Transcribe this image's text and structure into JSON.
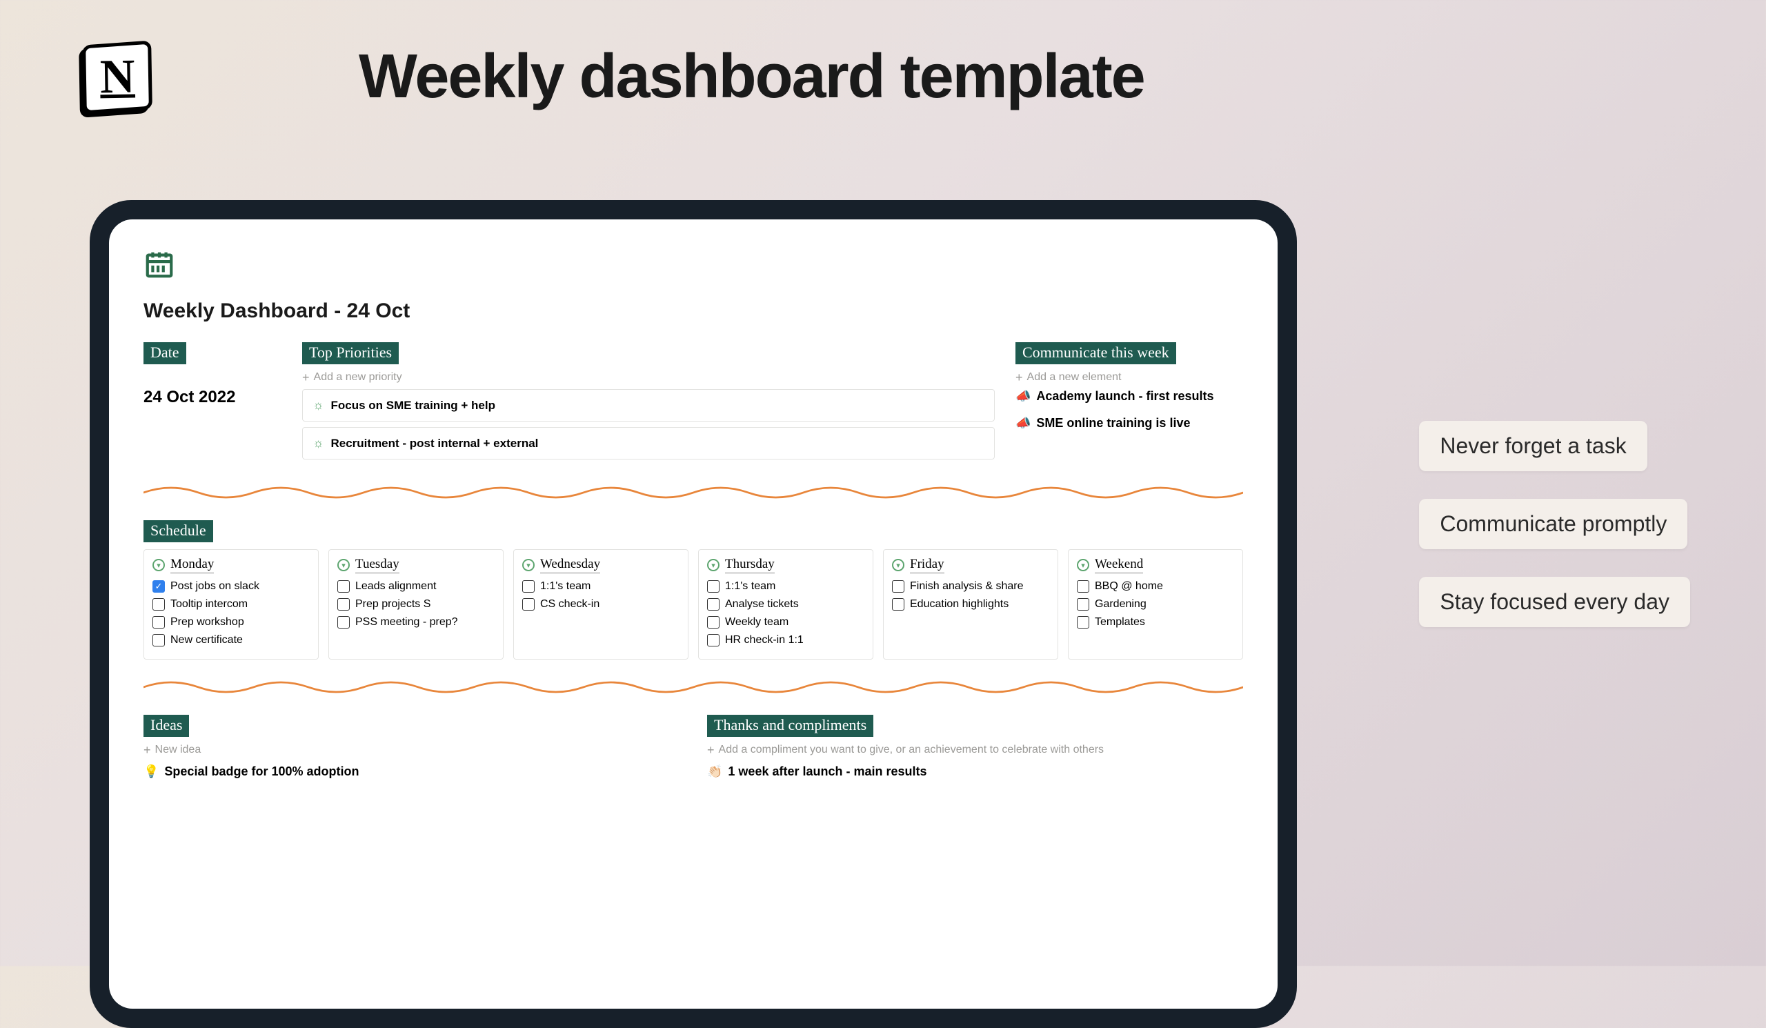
{
  "header": {
    "title": "Weekly dashboard template"
  },
  "page": {
    "title": "Weekly Dashboard - 24 Oct"
  },
  "sections": {
    "date": {
      "label": "Date",
      "value": "24 Oct 2022"
    },
    "priorities": {
      "label": "Top Priorities",
      "add": "Add a new priority",
      "items": [
        "Focus on SME training + help",
        "Recruitment - post internal + external"
      ]
    },
    "communicate": {
      "label": "Communicate this week",
      "add": "Add a new element",
      "items": [
        "Academy launch - first results",
        "SME online training is live"
      ]
    },
    "schedule": {
      "label": "Schedule",
      "days": [
        {
          "name": "Monday",
          "tasks": [
            {
              "text": "Post jobs on slack",
              "done": true
            },
            {
              "text": "Tooltip intercom",
              "done": false
            },
            {
              "text": "Prep  workshop",
              "done": false
            },
            {
              "text": "New certificate",
              "done": false
            }
          ]
        },
        {
          "name": "Tuesday",
          "tasks": [
            {
              "text": "Leads alignment",
              "done": false
            },
            {
              "text": "Prep projects S",
              "done": false
            },
            {
              "text": "PSS meeting - prep?",
              "done": false
            }
          ]
        },
        {
          "name": "Wednesday",
          "tasks": [
            {
              "text": "1:1's team",
              "done": false
            },
            {
              "text": "CS check-in",
              "done": false
            }
          ]
        },
        {
          "name": "Thursday",
          "tasks": [
            {
              "text": "1:1's team",
              "done": false
            },
            {
              "text": "Analyse tickets",
              "done": false
            },
            {
              "text": "Weekly team",
              "done": false
            },
            {
              "text": "HR check-in 1:1",
              "done": false
            }
          ]
        },
        {
          "name": "Friday",
          "tasks": [
            {
              "text": "Finish analysis & share",
              "done": false
            },
            {
              "text": "Education highlights",
              "done": false
            }
          ]
        },
        {
          "name": "Weekend",
          "tasks": [
            {
              "text": "BBQ @ home",
              "done": false
            },
            {
              "text": "Gardening",
              "done": false
            },
            {
              "text": "Templates",
              "done": false
            }
          ]
        }
      ]
    },
    "ideas": {
      "label": "Ideas",
      "add": "New idea",
      "items": [
        "Special badge for 100% adoption"
      ]
    },
    "thanks": {
      "label": "Thanks and compliments",
      "add": "Add a compliment you want to give, or an achievement to celebrate with others",
      "items": [
        "1 week after launch - main results"
      ]
    }
  },
  "callouts": [
    "Never forget a task",
    "Communicate promptly",
    "Stay focused every day"
  ]
}
